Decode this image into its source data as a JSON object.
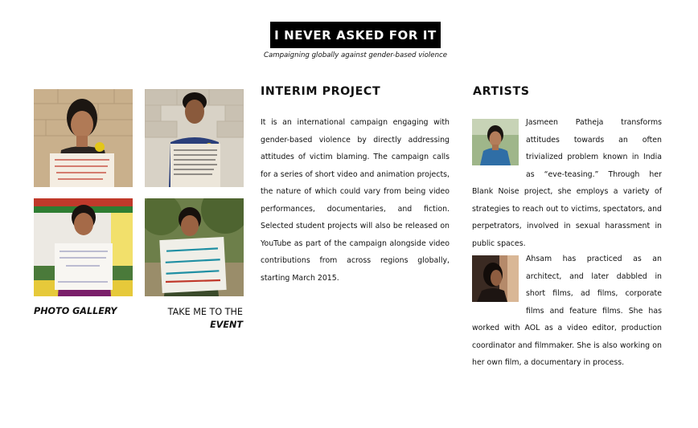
{
  "header": {
    "title": "I NEVER ASKED FOR IT",
    "subtitle": "Campaigning globally against gender-based violence"
  },
  "gallery": {
    "photo_gallery_label": "PHOTO GALLERY",
    "event_label_line1": "TAKE ME TO THE",
    "event_label_line2": "EVENT",
    "photos": [
      {
        "sign_text": "I, YESHWANTH... PLEDGE TO NOT BE AFRAID OF BEING VULNERABLE AND ENCOURAGE GUYS TO DO THE SAME"
      },
      {
        "sign_text": "I PLEDGE TO SPEAK UP"
      },
      {
        "sign_text": "I will not hesitate..."
      },
      {
        "sign_text": "I PLEDGE TO NOT SHY AWAY FROM STARING MEN"
      }
    ]
  },
  "interim": {
    "heading": "INTERIM PROJECT",
    "text": "It is an international campaign engaging with gender-based violence by directly addressing attitudes of victim blaming. The campaign calls for a series of short video and animation projects, the nature of which could vary from being video performances, documentaries, and fiction. Selected student projects will also be released on YouTube as part of the campaign alongside video contributions from across regions globally, starting March 2015."
  },
  "artists": {
    "heading": "ARTISTS",
    "items": [
      {
        "bio": "Jasmeen Patheja transforms attitudes towards an often trivialized problem known in India as “eve-teasing.” Through her Blank Noise project, she employs a variety of strategies to reach out to victims, spectators, and perpetrators, involved in sexual harassment in public spaces."
      },
      {
        "bio": "Ahsam has practiced as an architect, and later dabbled in short films, ad films, corporate films and feature films. She has worked with AOL as a video editor, production coordinator and filmmaker. She is also working on her own film, a documentary in process."
      }
    ]
  },
  "colors": {
    "title_bg": "#000000",
    "title_fg": "#ffffff",
    "text": "#111111"
  }
}
